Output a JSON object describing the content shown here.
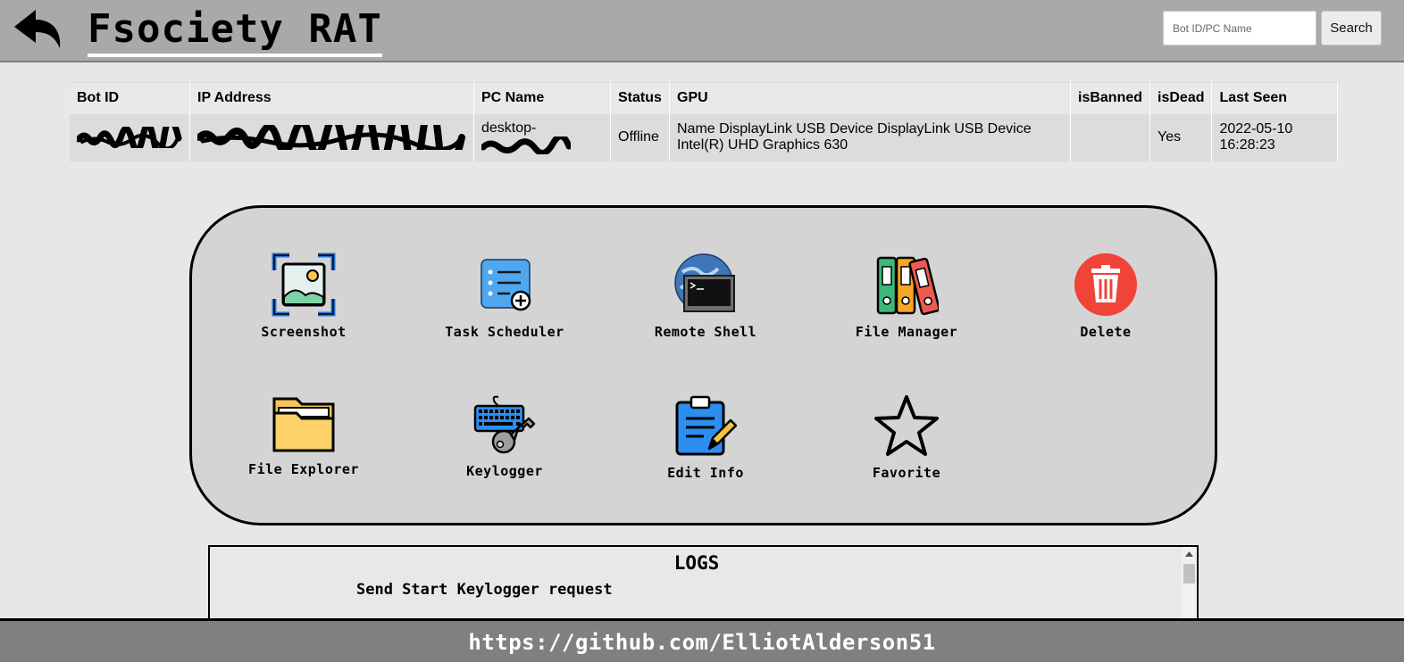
{
  "header": {
    "title": "Fsociety RAT",
    "search_placeholder": "Bot ID/PC Name",
    "search_label": "Search",
    "back_icon": "back-arrow-icon"
  },
  "table": {
    "columns": [
      "Bot ID",
      "IP Address",
      "PC Name",
      "Status",
      "GPU",
      "isBanned",
      "isDead",
      "Last Seen"
    ],
    "rows": [
      {
        "pc_name": "desktop-",
        "status": "Offline",
        "gpu_line1": "Name DisplayLink USB Device DisplayLink USB Device",
        "gpu_line2": "Intel(R) UHD Graphics 630",
        "is_banned": "",
        "is_dead": "Yes",
        "last_seen_date": "2022-05-10",
        "last_seen_time": "16:28:23"
      }
    ]
  },
  "tools": [
    {
      "label": "Screenshot",
      "icon": "screenshot-icon"
    },
    {
      "label": "Task Scheduler",
      "icon": "task-scheduler-icon"
    },
    {
      "label": "Remote Shell",
      "icon": "remote-shell-icon"
    },
    {
      "label": "File Manager",
      "icon": "file-manager-icon"
    },
    {
      "label": "Delete",
      "icon": "trash-icon"
    },
    {
      "label": "File Explorer",
      "icon": "folder-icon"
    },
    {
      "label": "Keylogger",
      "icon": "keyboard-key-icon"
    },
    {
      "label": "Edit Info",
      "icon": "clipboard-edit-icon"
    },
    {
      "label": "Favorite",
      "icon": "star-icon"
    }
  ],
  "logs": {
    "title": "LOGS",
    "lines": [
      "Send Start Keylogger request"
    ]
  },
  "footer": {
    "link": "https://github.com/ElliotAlderson51"
  },
  "colors": {
    "topbar": "#a9a9a9",
    "page_bg": "#e8e6e7",
    "panel_bg": "#d4d4d4",
    "footer_bg": "#808080",
    "delete_red": "#f04438"
  }
}
